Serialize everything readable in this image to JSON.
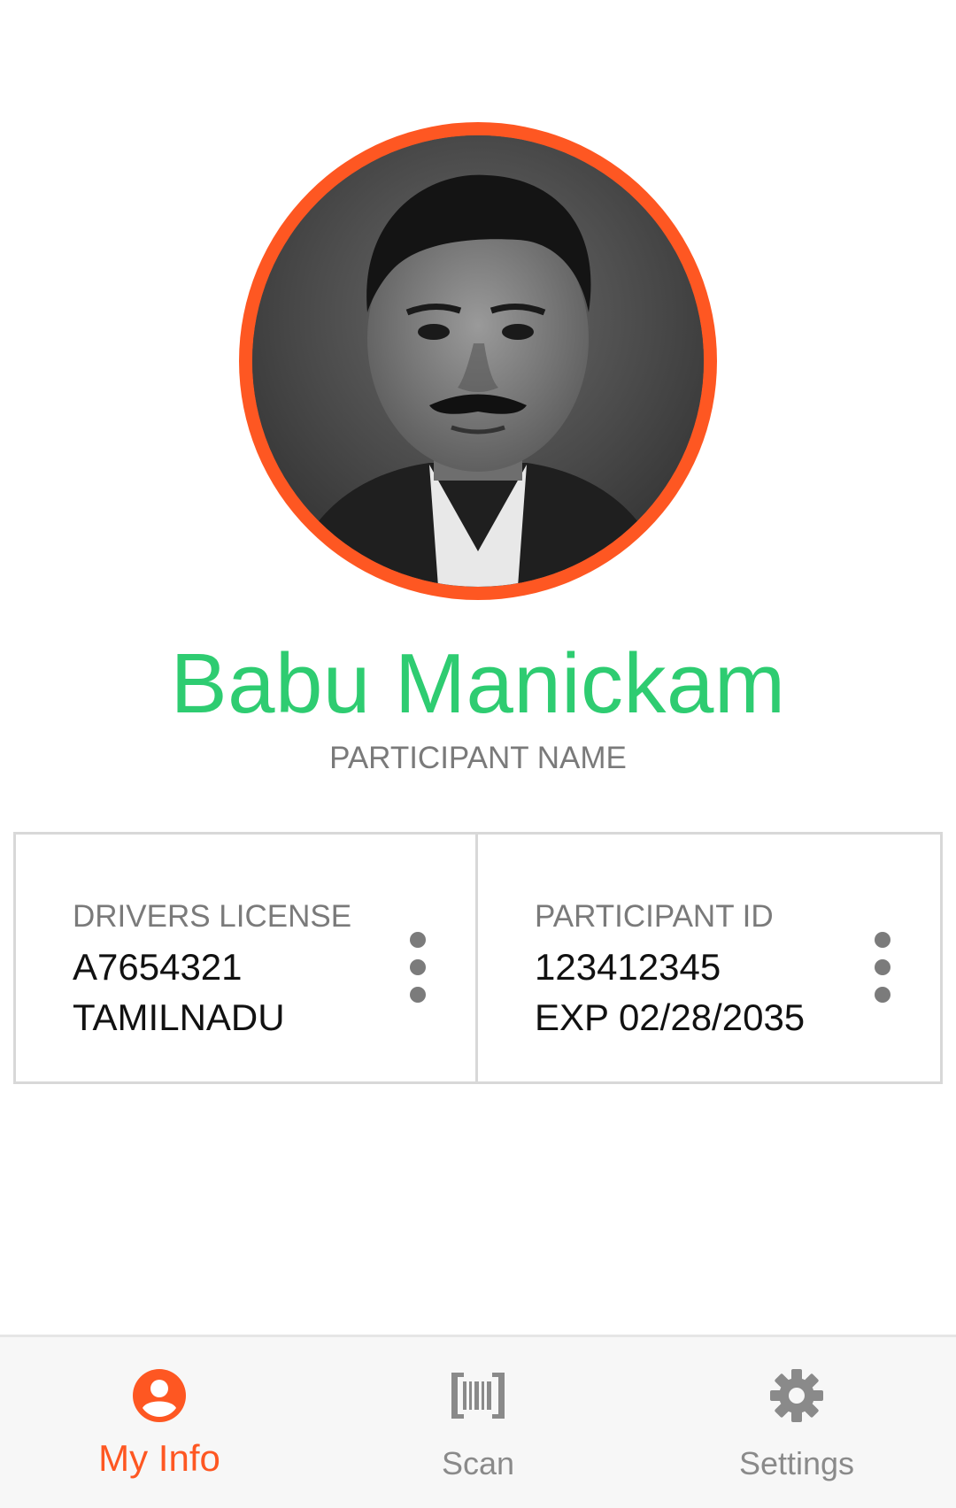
{
  "profile": {
    "name": "Babu Manickam",
    "name_caption": "PARTICIPANT NAME",
    "name_color": "#2ecc71",
    "ring_color": "#fe5722"
  },
  "cards": [
    {
      "label": "DRIVERS LICENSE",
      "line1": "A7654321",
      "line2": "TAMILNADU",
      "menu_icon": "more-vert-icon"
    },
    {
      "label": "PARTICIPANT ID",
      "line1": "123412345",
      "line2": "EXP 02/28/2035",
      "menu_icon": "more-vert-icon"
    }
  ],
  "bottom_nav": {
    "items": [
      {
        "label": "My Info",
        "icon": "account-circle-icon",
        "active": true
      },
      {
        "label": "Scan",
        "icon": "barcode-icon",
        "active": false
      },
      {
        "label": "Settings",
        "icon": "gear-icon",
        "active": false
      }
    ],
    "active_color": "#fe5722",
    "inactive_color": "#8a8a8a"
  }
}
